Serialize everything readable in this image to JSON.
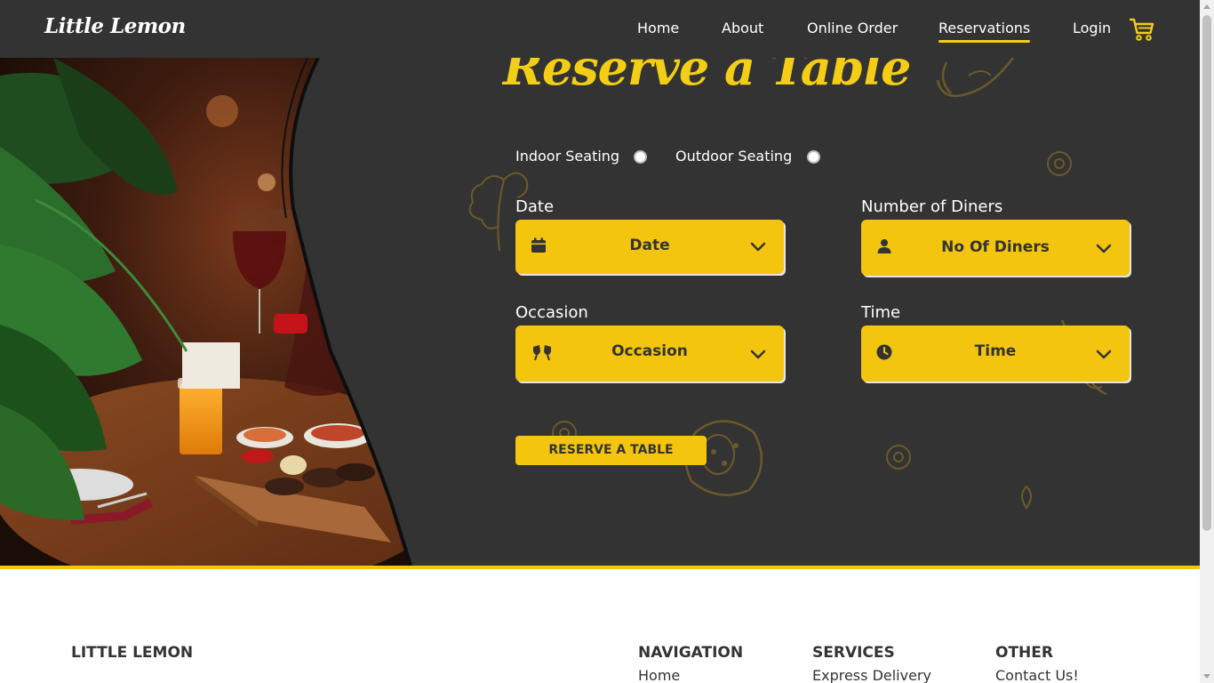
{
  "header": {
    "logo": "Little Lemon",
    "nav": [
      "Home",
      "About",
      "Online Order",
      "Reservations",
      "Login"
    ],
    "active_nav": "Reservations"
  },
  "main": {
    "title": "Reserve a Table",
    "seating": {
      "indoor_label": "Indoor Seating",
      "outdoor_label": "Outdoor Seating"
    },
    "fields": {
      "date": {
        "label": "Date",
        "value": "Date",
        "icon": "calendar-icon"
      },
      "diners": {
        "label": "Number of Diners",
        "value": "No Of Diners",
        "icon": "person-icon"
      },
      "occasion": {
        "label": "Occasion",
        "value": "Occasion",
        "icon": "cheers-icon"
      },
      "time": {
        "label": "Time",
        "value": "Time",
        "icon": "clock-icon"
      }
    },
    "reserve_button": "RESERVE A TABLE"
  },
  "footer": {
    "brand": "LITTLE LEMON",
    "navigation": {
      "title": "NAVIGATION",
      "first_link": "Home"
    },
    "services": {
      "title": "SERVICES",
      "first_link": "Express Delivery"
    },
    "other": {
      "title": "OTHER",
      "first_link": "Contact Us!"
    }
  },
  "colors": {
    "accent": "#F4CE14",
    "dark": "#333333",
    "button": "#F4C50E"
  }
}
